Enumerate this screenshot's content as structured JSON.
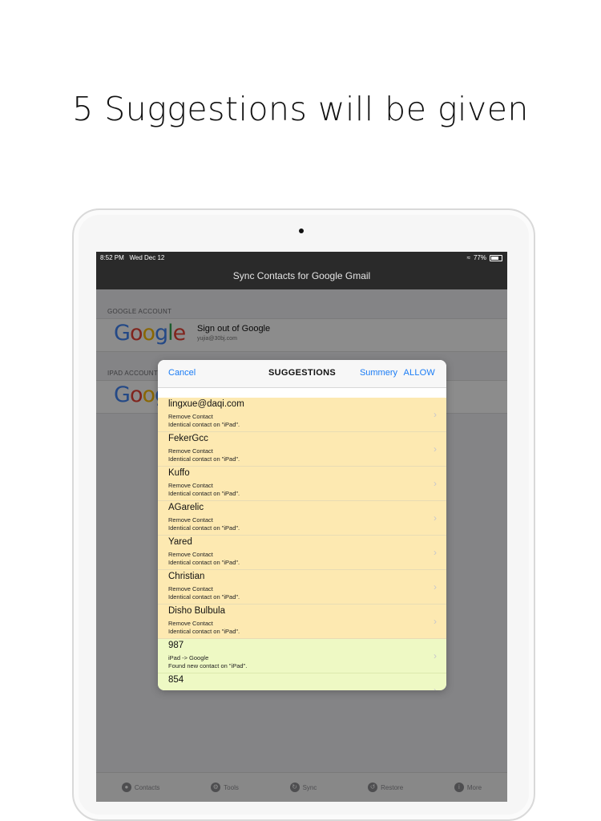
{
  "headline": "5 Suggestions will be given",
  "status": {
    "time": "8:52 PM",
    "date": "Wed Dec 12",
    "battery": "77%"
  },
  "navbar": {
    "title": "Sync Contacts for Google Gmail"
  },
  "google_section": {
    "label": "GOOGLE ACCOUNT",
    "logo": "Google",
    "title": "Sign out of Google",
    "email": "yujia@30bj.com"
  },
  "ipad_section": {
    "label": "IPAD ACCOUNT"
  },
  "tabbar": {
    "items": [
      {
        "label": "Contacts",
        "icon": "contacts-icon"
      },
      {
        "label": "Tools",
        "icon": "tools-icon"
      },
      {
        "label": "Sync",
        "icon": "sync-icon"
      },
      {
        "label": "Restore",
        "icon": "restore-icon"
      },
      {
        "label": "More",
        "icon": "info-icon"
      }
    ]
  },
  "modal": {
    "cancel": "Cancel",
    "title": "SUGGESTIONS",
    "summary": "Summery",
    "allow": "ALLOW",
    "rows": [
      {
        "name": "lingxue@daqi.com",
        "action": "Remove Contact",
        "detail": "Identical contact on \"iPad\".",
        "kind": "remove"
      },
      {
        "name": "FekerGcc",
        "action": "Remove Contact",
        "detail": "Identical contact on \"iPad\".",
        "kind": "remove"
      },
      {
        "name": "Kuffo",
        "action": "Remove Contact",
        "detail": "Identical contact on \"iPad\".",
        "kind": "remove"
      },
      {
        "name": "AGarelic",
        "action": "Remove Contact",
        "detail": "Identical contact on \"iPad\".",
        "kind": "remove"
      },
      {
        "name": "Yared",
        "action": "Remove Contact",
        "detail": "Identical contact on \"iPad\".",
        "kind": "remove"
      },
      {
        "name": "Christian",
        "action": "Remove Contact",
        "detail": "Identical contact on \"iPad\".",
        "kind": "remove"
      },
      {
        "name": "Disho Bulbula",
        "action": "Remove Contact",
        "detail": "Identical contact on \"iPad\".",
        "kind": "remove"
      },
      {
        "name": "987",
        "action": "iPad -> Google",
        "detail": "Found new contact on \"iPad\".",
        "kind": "add"
      },
      {
        "name": "854",
        "action": "",
        "detail": "",
        "kind": "add"
      }
    ]
  },
  "colors": {
    "accent": "#1a7cf5",
    "remove_row": "#fde9b1",
    "add_row": "#eef9c4"
  }
}
